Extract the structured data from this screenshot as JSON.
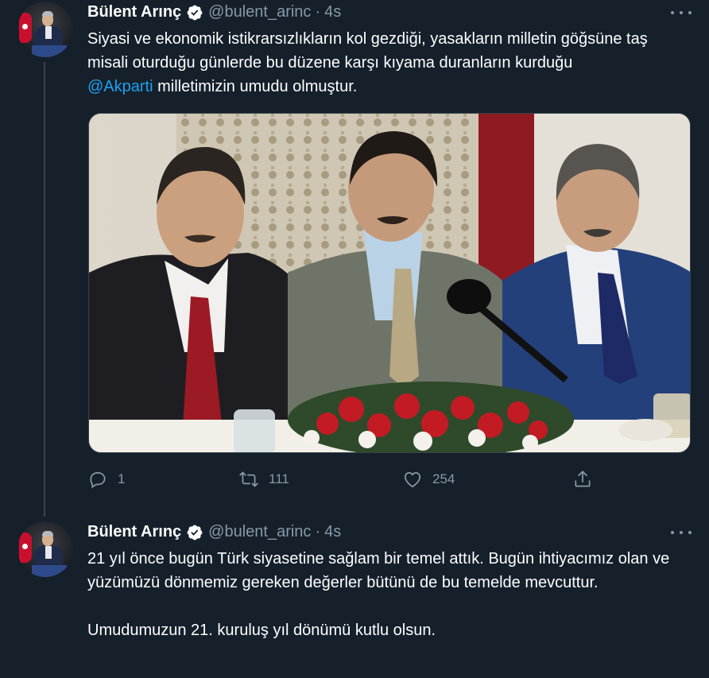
{
  "tweets": [
    {
      "author": {
        "name": "Bülent Arınç",
        "handle": "@bulent_arinc",
        "verified": true
      },
      "time": "4s",
      "separator": "·",
      "text_before_mention": "Siyasi ve ekonomik istikrarsızlıkların kol gezdiği, yasakların milletin göğsüne taş misali oturduğu günlerde bu düzene karşı kıyama duranların kurduğu",
      "mention": "@Akparti",
      "text_after_mention": " milletimizin umudu olmuştur.",
      "media": "photo",
      "stats": {
        "replies": "1",
        "retweets": "111",
        "likes": "254"
      }
    },
    {
      "author": {
        "name": "Bülent Arınç",
        "handle": "@bulent_arinc",
        "verified": true
      },
      "time": "4s",
      "separator": "·",
      "text": "21 yıl önce bugün Türk siyasetine sağlam bir temel attık. Bugün ihtiyacımız olan ve yüzümüzü dönmemiz gereken değerler bütünü de bu temelde mevcuttur.\n\nUmudumuzun 21. kuruluş yıl dönümü kutlu olsun."
    }
  ],
  "icons": {
    "more": "more-horizontal-icon",
    "reply": "reply-icon",
    "retweet": "retweet-icon",
    "like": "heart-icon",
    "share": "share-icon",
    "verified": "verified-badge-icon"
  },
  "colors": {
    "background": "#15202b",
    "secondary_text": "#8899a6",
    "accent": "#1da1f2",
    "divider": "#38444d"
  }
}
